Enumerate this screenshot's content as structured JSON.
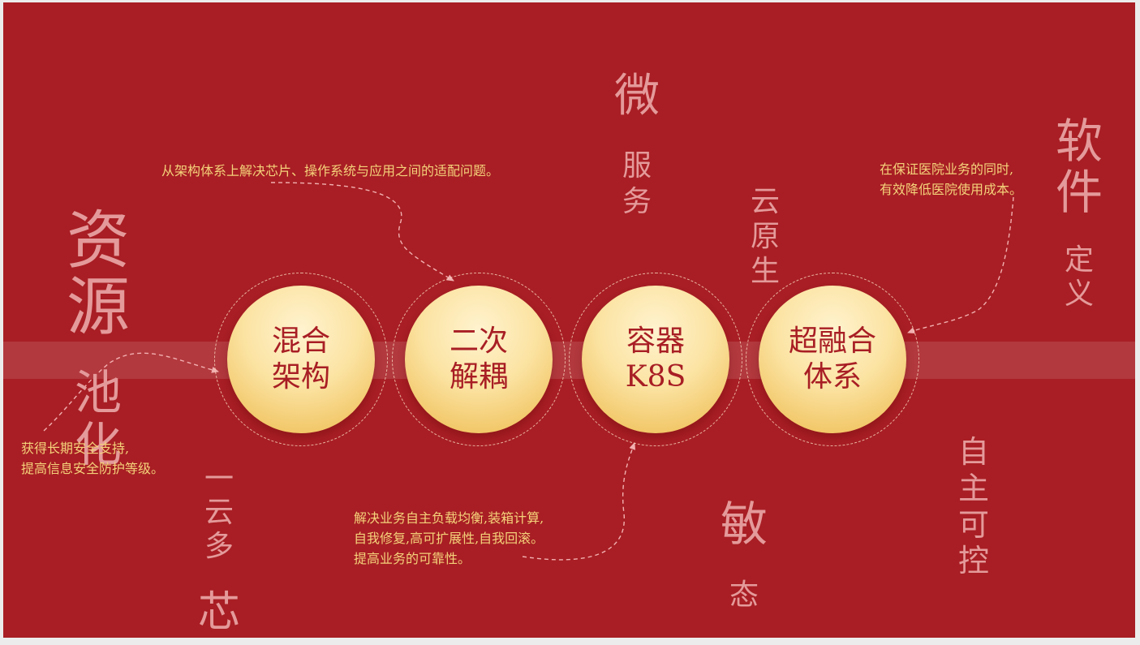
{
  "slide": {
    "background_color": "#a81e24",
    "accent_text_color": "#f4d27a",
    "faded_text_color": "#e49a9a",
    "circle_text_color": "#a81e24"
  },
  "circles": [
    {
      "label": "混合\n架构"
    },
    {
      "label": "二次\n解耦"
    },
    {
      "label": "容器\nK8S"
    },
    {
      "label": "超融合\n体系"
    }
  ],
  "keywords": {
    "resource_pool": {
      "big": "资\n源",
      "rest": "池\n化"
    },
    "one_cloud": {
      "rest": "一\n云\n多",
      "big": "芯"
    },
    "microservice": {
      "big": "微",
      "rest": "服\n务"
    },
    "cloud_native": {
      "text": "云\n原\n生"
    },
    "agile": {
      "big": "敏",
      "rest": "态"
    },
    "software_defined": {
      "big": "软\n件",
      "rest": "定\n义"
    },
    "autonomous": {
      "text": "自\n主\n可\n控"
    }
  },
  "descriptions": {
    "architecture": "从架构体系上解决芯片、操作系统与应用之间的适配问题。",
    "cost": "在保证医院业务的同时,\n有效降低医院使用成本。",
    "security": "获得长期安全支持,\n提高信息安全防护等级。",
    "container": "解决业务自主负载均衡,装箱计算,\n自我修复,高可扩展性,自我回滚。\n提高业务的可靠性。"
  }
}
